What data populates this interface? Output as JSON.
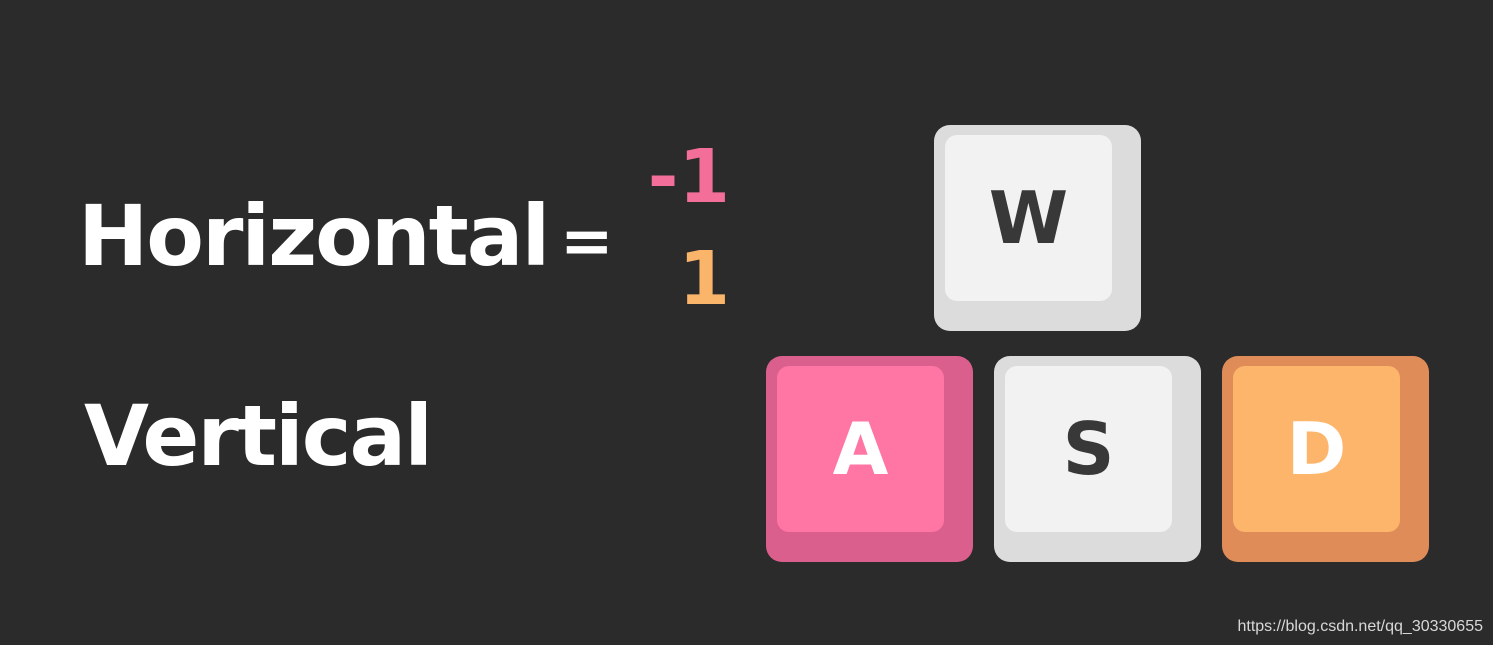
{
  "labels": {
    "horizontal": "Horizontal",
    "vertical": "Vertical",
    "equals": "="
  },
  "values": {
    "negative": "-1",
    "positive": "1",
    "negative_color": "#f36f9a",
    "positive_color": "#fbb56b"
  },
  "keys": {
    "w": {
      "label": "W",
      "base_color": "#dcdcdc",
      "cap_color": "#f2f2f2",
      "text_color": "#383838"
    },
    "a": {
      "label": "A",
      "base_color": "#db5f8d",
      "cap_color": "#ff75a3",
      "text_color": "#ffffff"
    },
    "s": {
      "label": "S",
      "base_color": "#dcdcdc",
      "cap_color": "#f2f2f2",
      "text_color": "#383838"
    },
    "d": {
      "label": "D",
      "base_color": "#df8c58",
      "cap_color": "#fdb56c",
      "text_color": "#ffffff"
    }
  },
  "watermark": "https://blog.csdn.net/qq_30330655"
}
